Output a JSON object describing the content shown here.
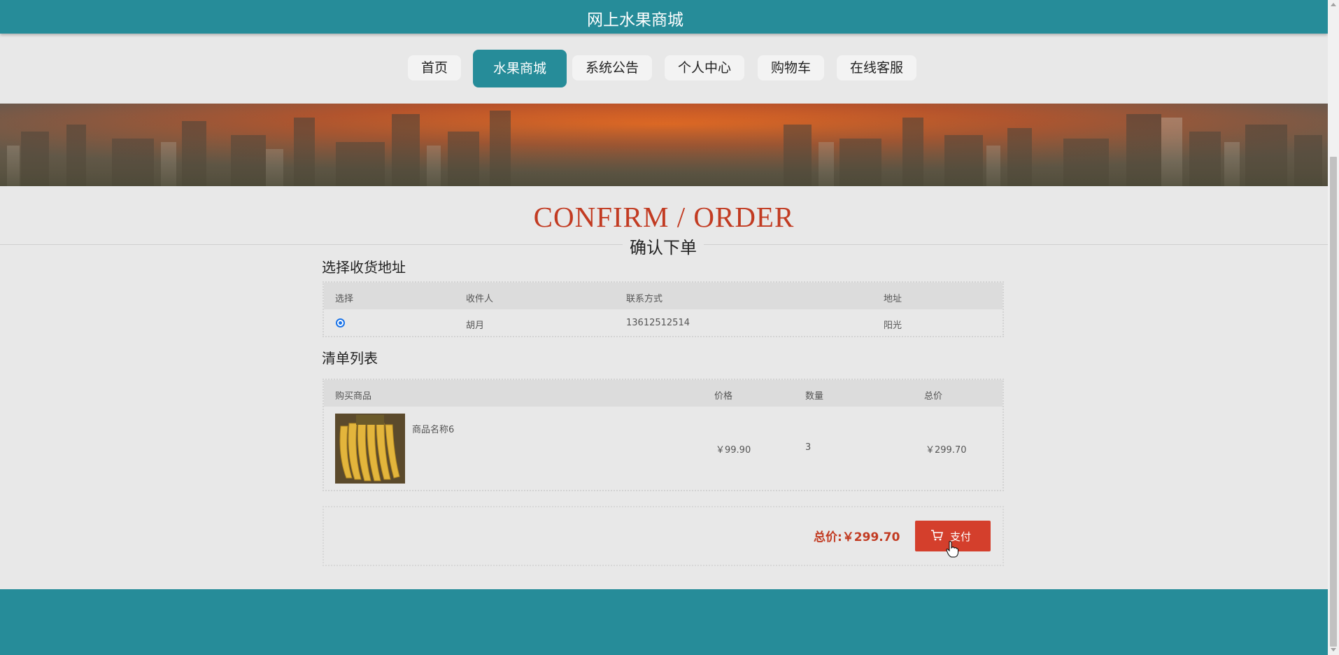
{
  "header": {
    "site_title": "网上水果商城"
  },
  "nav": {
    "items": [
      {
        "label": "首页"
      },
      {
        "label": "水果商城",
        "active": true
      },
      {
        "label": "系统公告"
      },
      {
        "label": "个人中心"
      },
      {
        "label": "购物车"
      },
      {
        "label": "在线客服"
      }
    ]
  },
  "main": {
    "title_en": "CONFIRM / ORDER",
    "title_cn": "确认下单",
    "address_section": {
      "title": "选择收货地址",
      "columns": [
        "选择",
        "收件人",
        "联系方式",
        "地址"
      ],
      "rows": [
        {
          "selected": true,
          "recipient": "胡月",
          "phone": "13612512514",
          "address": "阳光"
        }
      ]
    },
    "list_section": {
      "title": "清单列表",
      "columns": [
        "购买商品",
        "价格",
        "数量",
        "总价"
      ],
      "rows": [
        {
          "product_name": "商品名称6",
          "image": "banana-image",
          "price": "￥99.90",
          "quantity": "3",
          "total": "￥299.70"
        }
      ]
    },
    "summary": {
      "total_label": "总价:",
      "total_value": "￥299.70",
      "pay_label": "支付",
      "pay_icon": "cart-icon"
    }
  },
  "colors": {
    "brand": "#268c99",
    "accent": "#c23b22",
    "pay_button": "#d43f2c"
  }
}
